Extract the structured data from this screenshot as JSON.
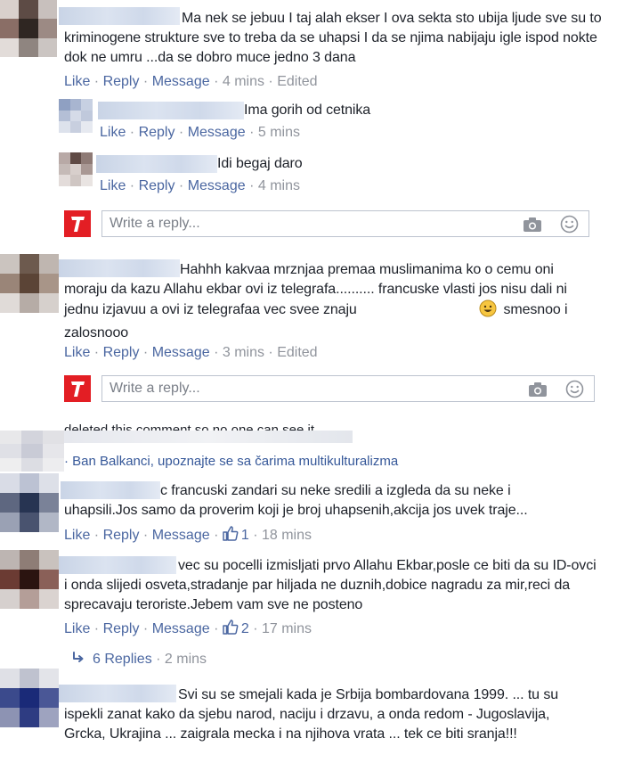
{
  "actions": {
    "like": "Like",
    "reply": "Reply",
    "message": "Message",
    "sep": " · "
  },
  "comments": [
    {
      "text": "Ma nek se jebuu I taj alah ekser I ova sekta sto ubija ljude sve su to kriminogene strukture sve to treba da se uhapsi I da se njima nabijaju igle ispod nokte dok ne umru ...da se dobro muce jedno 3 dana",
      "time": "4 mins",
      "edited": "Edited",
      "replies": [
        {
          "text": "Ima gorih od cetnika",
          "time": "5 mins"
        },
        {
          "text": "Idi begaj daro",
          "time": "4 mins"
        }
      ],
      "reply_placeholder": "Write a reply..."
    },
    {
      "text_before": "Hahhh kakvaa mrznjaa premaa muslimanima ko o cemu oni moraju da kazu Allahu ekbar ovi iz telegrafa.......... francuske vlasti jos nisu dali ni jednu izjavuu a ovi iz telegrafaa vec svee znaju",
      "text_after": "smesnoo i zalosnooo",
      "time": "3 mins",
      "edited": "Edited",
      "reply_placeholder": "Write a reply..."
    },
    {
      "deleted_text": "deleted this comment so no one can see it",
      "page_text": "· Ban Balkanci, upoznajte se sa čarima multikulturalizma"
    },
    {
      "text": "c francuski zandari su neke sredili a izgleda da su neke i uhapsili.Jos samo da proverim koji je broj uhapsenih,akcija jos uvek traje...",
      "likes": "1",
      "time": "18 mins"
    },
    {
      "text": "vec su pocelli izmisljati prvo Allahu Ekbar,posle ce biti da su ID-ovci i onda slijedi osveta,stradanje par hiljada ne duznih,dobice nagradu za mir,reci da sprecavaju teroriste.Jebem vam sve ne posteno",
      "likes": "2",
      "time": "17 mins",
      "replies_link": "6 Replies",
      "replies_time": "2 mins"
    },
    {
      "text": "Svi su se smejali kada je Srbija bombardovana 1999. ... tu su ispekli zanat kako da sjebu narod, naciju i drzavu, a onda redom - Jugoslavija, Grcka, Ukrajina ... zaigrala mecka i na njihova vrata ... tek ce biti sranja!!!"
    }
  ],
  "colors": {
    "link": "#4b67a1",
    "muted": "#90949c",
    "brand": "#e31e24"
  },
  "icons": [
    "camera-icon",
    "smiley-icon",
    "thumbs-up-icon",
    "reply-arrow-icon",
    "telegraf-logo-icon"
  ]
}
